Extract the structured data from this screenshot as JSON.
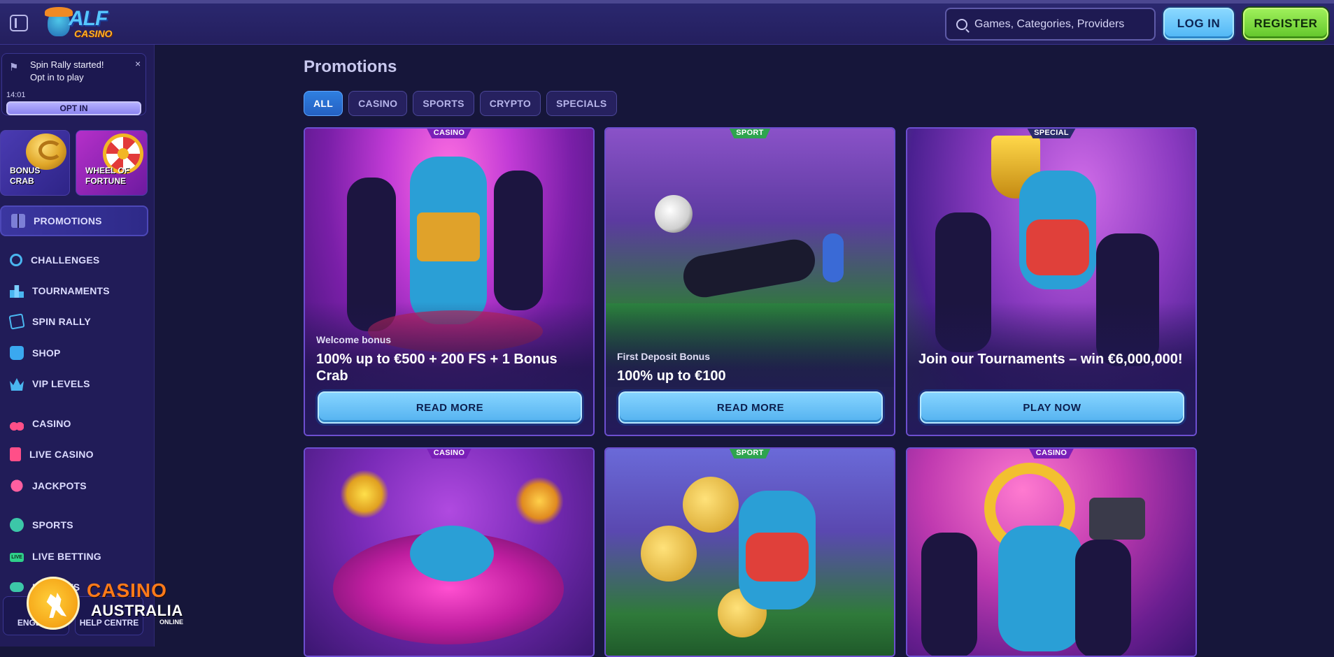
{
  "header": {
    "logo_line1": "ALF",
    "logo_line2": "CASINO",
    "search_placeholder": "Games, Categories, Providers",
    "login_label": "LOG IN",
    "register_label": "REGISTER"
  },
  "notification": {
    "title": "Spin Rally started!",
    "subtitle": "Opt in to play",
    "time": "14:01",
    "button_label": "OPT IN",
    "close_glyph": "×"
  },
  "sidebar": {
    "tiles": [
      {
        "label_line1": "BONUS",
        "label_line2": "CRAB"
      },
      {
        "label_line1": "WHEEL OF",
        "label_line2": "FORTUNE"
      }
    ],
    "active_item": {
      "label": "PROMOTIONS",
      "icon": "gift-icon"
    },
    "items": [
      {
        "label": "CHALLENGES",
        "icon": "medal-icon"
      },
      {
        "label": "TOURNAMENTS",
        "icon": "podium-icon"
      },
      {
        "label": "SPIN RALLY",
        "icon": "flag-icon"
      },
      {
        "label": "SHOP",
        "icon": "shopping-bag-icon"
      },
      {
        "label": "VIP LEVELS",
        "icon": "crown-icon"
      },
      {
        "label": "CASINO",
        "icon": "cherry-icon"
      },
      {
        "label": "LIVE CASINO",
        "icon": "card-icon"
      },
      {
        "label": "JACKPOTS",
        "icon": "clover-icon"
      },
      {
        "label": "SPORTS",
        "icon": "soccer-ball-icon"
      },
      {
        "label": "LIVE BETTING",
        "icon": "live-badge-icon"
      },
      {
        "label": "ESPORTS",
        "icon": "gamepad-icon"
      }
    ],
    "language_label": "ENGLISH",
    "help_label": "HELP CENTRE",
    "live_badge_text": "LIVE"
  },
  "watermark": {
    "line1": "CASINO",
    "line2": "AUSTRALIA",
    "line3": "ONLINE"
  },
  "main": {
    "title": "Promotions",
    "filters": [
      {
        "label": "ALL",
        "active": true
      },
      {
        "label": "CASINO",
        "active": false
      },
      {
        "label": "SPORTS",
        "active": false
      },
      {
        "label": "CRYPTO",
        "active": false
      },
      {
        "label": "SPECIALS",
        "active": false
      }
    ],
    "cards": [
      {
        "badge": "CASINO",
        "subtitle": "Welcome bonus",
        "title": "100% up to €500 + 200 FS + 1 Bonus Crab",
        "button": "READ MORE"
      },
      {
        "badge": "SPORT",
        "subtitle": "First Deposit Bonus",
        "title": "100% up to €100",
        "button": "READ MORE"
      },
      {
        "badge": "SPECIAL",
        "subtitle": "",
        "title": "Join our Tournaments – win €6,000,000!",
        "button": "PLAY NOW"
      },
      {
        "badge": "CASINO"
      },
      {
        "badge": "SPORT"
      },
      {
        "badge": "CASINO"
      }
    ]
  },
  "colors": {
    "background": "#16163a",
    "sidebar": "#211c58",
    "accent_blue": "#54b2f0",
    "register_green": "#61c52a",
    "casino_badge": "#7a1fb8",
    "sport_badge": "#2ea44f"
  }
}
